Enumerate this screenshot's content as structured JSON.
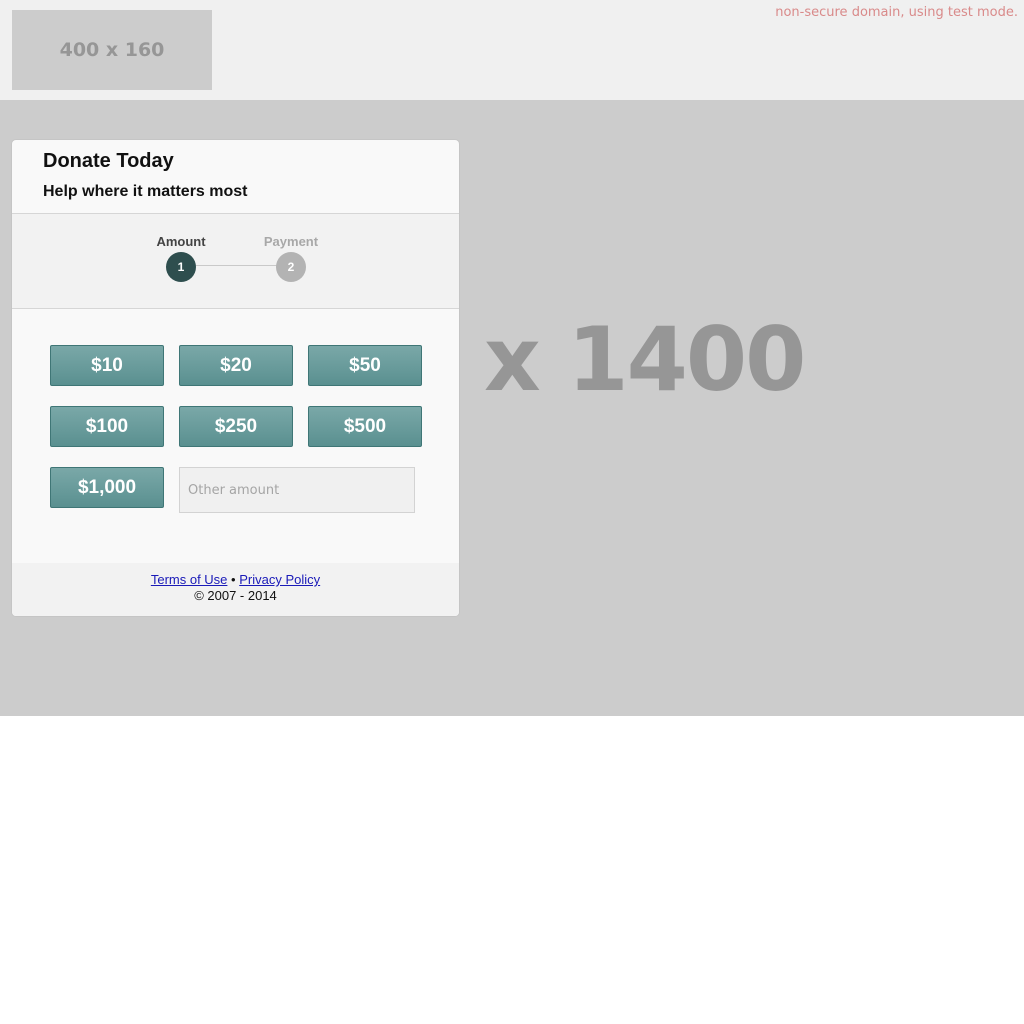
{
  "topbar": {
    "logo_placeholder": "400 x 160",
    "test_mode_notice": "non-secure domain, using test mode."
  },
  "hero": {
    "placeholder_text": "x 1400"
  },
  "card": {
    "title": "Donate Today",
    "subtitle": "Help where it matters most",
    "steps": [
      {
        "label": "Amount",
        "number": "1",
        "state": "active"
      },
      {
        "label": "Payment",
        "number": "2",
        "state": "inactive"
      }
    ],
    "amounts": [
      "$10",
      "$20",
      "$50",
      "$100",
      "$250",
      "$500",
      "$1,000"
    ],
    "other_amount_placeholder": "Other amount",
    "footer": {
      "terms_label": "Terms of Use",
      "separator": "•",
      "privacy_label": "Privacy Policy",
      "copyright": "© 2007 - 2014"
    }
  },
  "colors": {
    "button_top": "#7aa8a8",
    "button_bottom": "#5a9090",
    "active_step": "#2e4e4e",
    "inactive_step": "#b3b3b3",
    "test_mode_text": "#d98a8a"
  }
}
